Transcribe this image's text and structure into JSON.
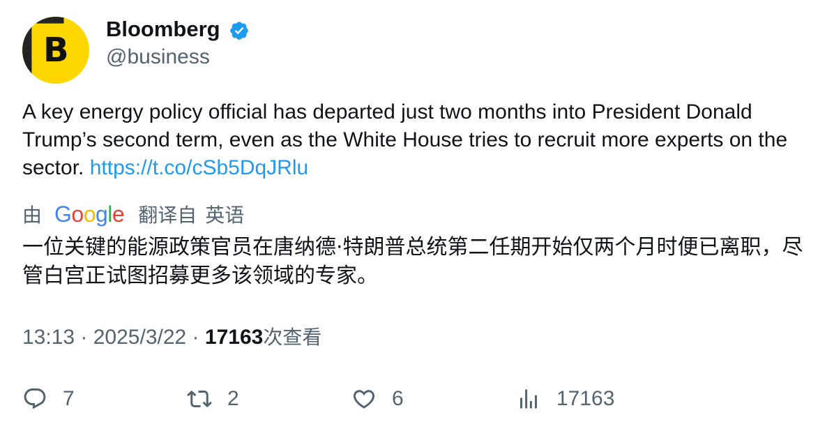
{
  "author": {
    "avatar_letter": "B",
    "display_name": "Bloomberg",
    "handle": "@business",
    "verified": true,
    "verified_color": "#1d9bf0"
  },
  "tweet": {
    "text": "A key energy policy official has departed just two months into President Donald Trump’s second term, even as the White House tries to recruit more experts on the sector. ",
    "link": "https://t.co/cSb5DqJRlu",
    "link_color": "#1d9bf0"
  },
  "translation": {
    "by_label": "由",
    "provider": "Google",
    "from_label": "翻译自",
    "language": "英语",
    "text": "一位关键的能源政策官员在唐纳德·特朗普总统第二任期开始仅两个月时便已离职，尽管白宫正试图招募更多该领域的专家。"
  },
  "meta": {
    "time": "13:13",
    "separator": " · ",
    "date": "2025/3/22",
    "views_count": "17163",
    "views_label": "次查看"
  },
  "actions": {
    "replies": "7",
    "retweets": "2",
    "likes": "6",
    "views": "17163"
  },
  "icons": {
    "reply": "reply-bubble-icon",
    "retweet": "retweet-arrows-icon",
    "like": "heart-icon",
    "views": "bar-chart-icon",
    "verified": "verified-badge-icon"
  }
}
